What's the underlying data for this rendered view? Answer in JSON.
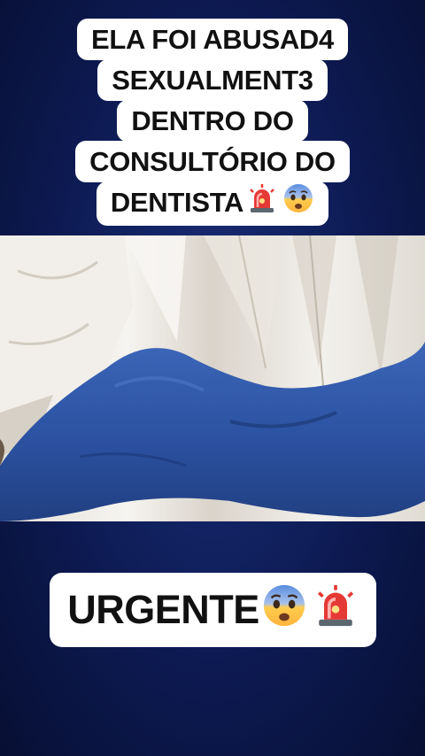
{
  "top_caption": {
    "lines": [
      "ELA FOI ABUSAD4",
      "SEXUALMENT3",
      "DENTRO DO",
      "CONSULTÓRIO DO",
      "DENTISTA"
    ],
    "emojis": [
      "siren-emoji",
      "fearful-face-emoji"
    ]
  },
  "bottom_caption": {
    "text": "URGENTE",
    "emojis": [
      "fearful-face-emoji",
      "siren-emoji"
    ]
  },
  "colors": {
    "background": "#0d1a52",
    "caption_bg": "#ffffff",
    "caption_text": "#111111",
    "sleeve_blue": "#2f56a8",
    "fabric_white": "#eeebe5",
    "siren_red": "#e53935"
  }
}
